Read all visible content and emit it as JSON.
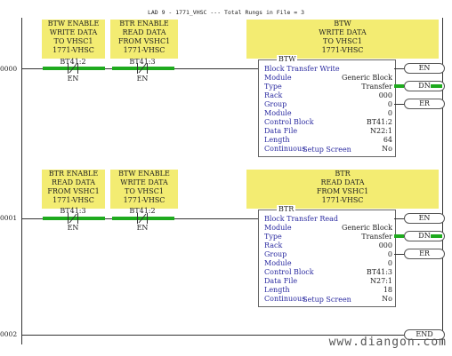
{
  "top_caption": "",
  "file_header": "LAD 9 - 1771_VHSC --- Total Rungs in File = 3",
  "rungs": [
    {
      "number": "0000",
      "comments": [
        "BTW ENABLE\nWRITE DATA\nTO VHSC1\n1771-VHSC",
        "BTR ENABLE\nREAD DATA\nFROM VSHC1\n1771-VHSC"
      ],
      "contacts": [
        {
          "tag": "BT41:2",
          "label": "EN"
        },
        {
          "tag": "BT41:3",
          "label": "EN"
        }
      ],
      "block_comment": "BTW\nWRITE DATA\nTO VHSC1\n1771-VHSC",
      "block": {
        "name": "BTW",
        "title": "Block Transfer Write",
        "rows": [
          {
            "label": "Module Type",
            "value": "Generic Block Transfer"
          },
          {
            "label": "Rack",
            "value": "000"
          },
          {
            "label": "Group",
            "value": "0"
          },
          {
            "label": "Module",
            "value": "0"
          },
          {
            "label": "Control Block",
            "value": "BT41:2"
          },
          {
            "label": "Data File",
            "value": "N22:1"
          },
          {
            "label": "Length",
            "value": "64"
          },
          {
            "label": "Continuous",
            "value": "No"
          }
        ],
        "setup": "Setup Screen",
        "outputs": [
          "EN",
          "DN",
          "ER"
        ]
      }
    },
    {
      "number": "0001",
      "comments": [
        "BTR ENABLE\nREAD DATA\nFROM VSHC1\n1771-VHSC",
        "BTW ENABLE\nWRITE DATA\nTO VHSC1\n1771-VHSC"
      ],
      "contacts": [
        {
          "tag": "BT41:3",
          "label": "EN"
        },
        {
          "tag": "BT41:2",
          "label": "EN"
        }
      ],
      "block_comment": "BTR\nREAD DATA\nFROM VSHC1\n1771-VHSC",
      "block": {
        "name": "BTR",
        "title": "Block Transfer Read",
        "rows": [
          {
            "label": "Module Type",
            "value": "Generic Block Transfer"
          },
          {
            "label": "Rack",
            "value": "000"
          },
          {
            "label": "Group",
            "value": "0"
          },
          {
            "label": "Module",
            "value": "0"
          },
          {
            "label": "Control Block",
            "value": "BT41:3"
          },
          {
            "label": "Data File",
            "value": "N27:1"
          },
          {
            "label": "Length",
            "value": "18"
          },
          {
            "label": "Continuous",
            "value": "No"
          }
        ],
        "setup": "Setup Screen",
        "outputs": [
          "EN",
          "DN",
          "ER"
        ]
      }
    },
    {
      "number": "0002",
      "end_label": "END"
    }
  ],
  "watermark": "www.diangon.com",
  "colors": {
    "comment_bg": "#f3ec72",
    "energized_green": "#1eaa1e",
    "block_text": "#2a2aa0"
  }
}
